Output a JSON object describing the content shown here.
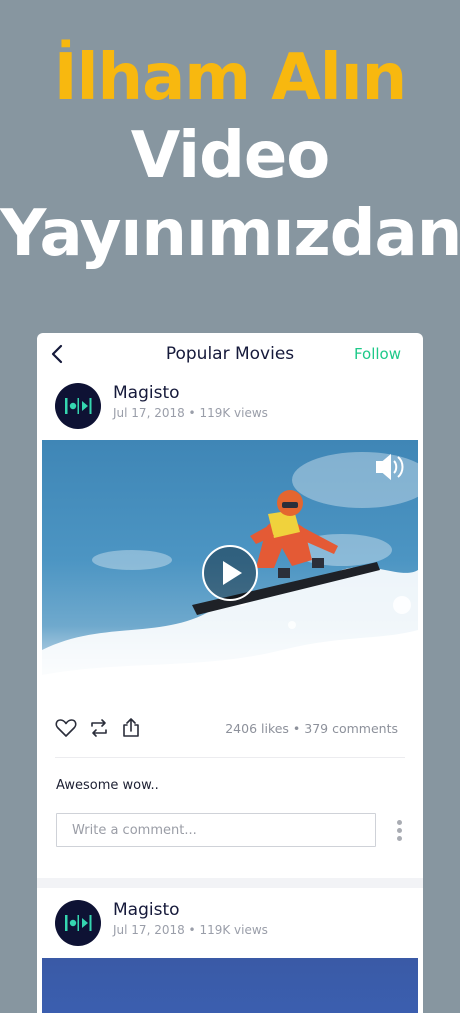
{
  "headline": {
    "line1": "İlham Alın",
    "line2": "Video",
    "line3": "Yayınımızdan",
    "accent_color": "#f8b80f"
  },
  "nav": {
    "back_icon": "chevron-left-icon",
    "title": "Popular Movies",
    "follow_label": "Follow",
    "follow_color": "#1ec989"
  },
  "posts": [
    {
      "author": "Magisto",
      "meta": "Jul 17, 2018 • 119K views",
      "likes_comments": "2406 likes • 379 comments",
      "caption": "Awesome wow..",
      "comment_placeholder": "Write a comment..."
    },
    {
      "author": "Magisto",
      "meta": "Jul 17, 2018 • 119K views"
    }
  ]
}
